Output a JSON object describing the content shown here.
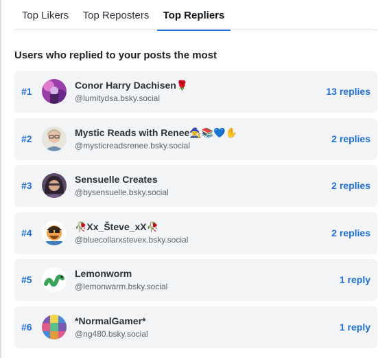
{
  "tabs": [
    {
      "label": "Top Likers",
      "active": false
    },
    {
      "label": "Top Reposters",
      "active": false
    },
    {
      "label": "Top Repliers",
      "active": true
    }
  ],
  "section_title": "Users who replied to your posts the most",
  "accent_color": "#1f6fd6",
  "repliers": [
    {
      "rank": "#1",
      "name": "Conor Harry Dachisen🌹",
      "handle": "@lumitydsa.bsky.social",
      "count": "13 replies"
    },
    {
      "rank": "#2",
      "name": "Mystic Reads with Renee🧙‍♀️📚💙✋",
      "handle": "@mysticreadsrenee.bsky.social",
      "count": "2 replies"
    },
    {
      "rank": "#3",
      "name": "Sensuelle Creates",
      "handle": "@bysensuelle.bsky.social",
      "count": "2 replies"
    },
    {
      "rank": "#4",
      "name": "🥀Xx_Števe_xX🥀",
      "handle": "@bluecollarxstevex.bsky.social",
      "count": "2 replies"
    },
    {
      "rank": "#5",
      "name": "Lemonworm",
      "handle": "@lemonwarm.bsky.social",
      "count": "1 reply"
    },
    {
      "rank": "#6",
      "name": "*NormalGamer*",
      "handle": "@ng480.bsky.social",
      "count": "1 reply"
    }
  ]
}
